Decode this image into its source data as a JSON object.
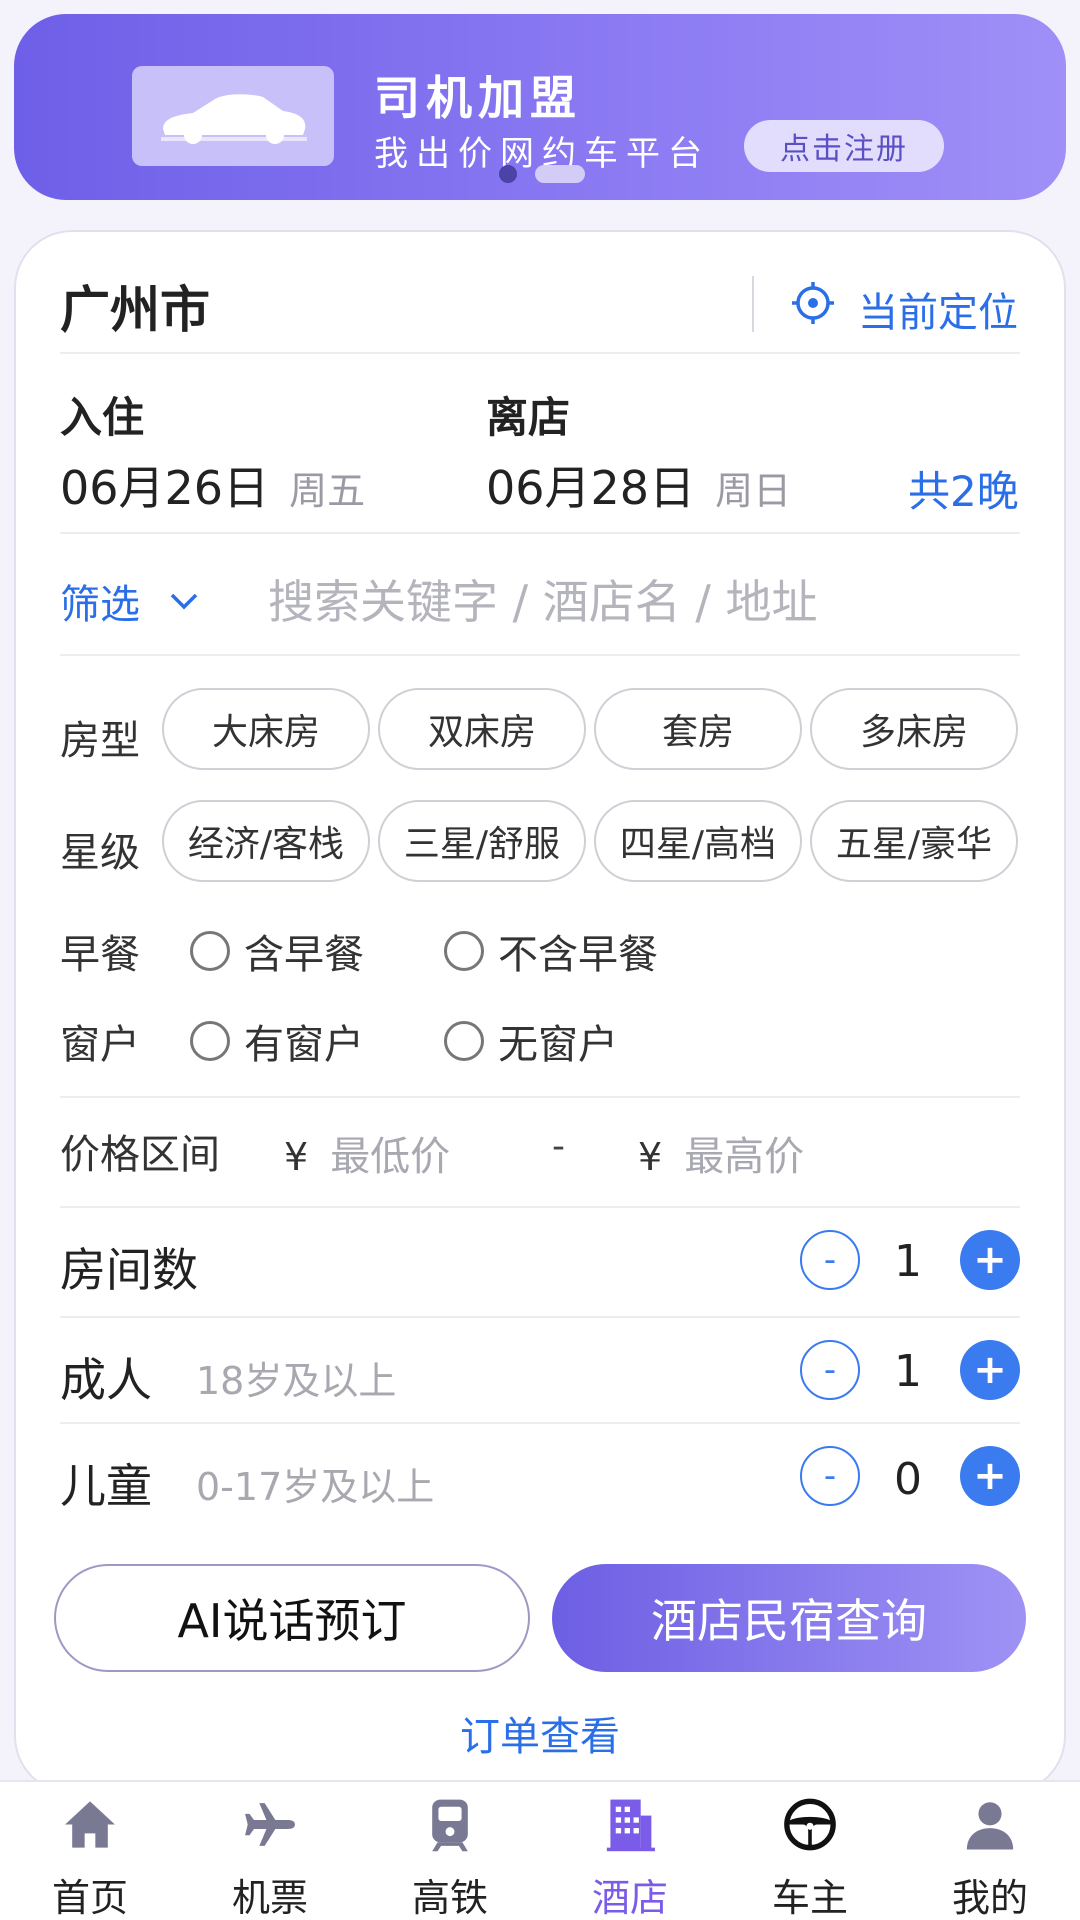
{
  "banner": {
    "title": "司机加盟",
    "subtitle": "我出价网约车平台",
    "button": "点击注册"
  },
  "location": {
    "city": "广州市",
    "current_location": "当前定位"
  },
  "dates": {
    "checkin_label": "入住",
    "checkin_date": "06月26日",
    "checkin_week": "周五",
    "checkout_label": "离店",
    "checkout_date": "06月28日",
    "checkout_week": "周日",
    "nights": "共2晚"
  },
  "search": {
    "filter_label": "筛选",
    "placeholder": "搜索关键字 / 酒店名 / 地址"
  },
  "room_type": {
    "label": "房型",
    "options": [
      "大床房",
      "双床房",
      "套房",
      "多床房"
    ]
  },
  "star": {
    "label": "星级",
    "options": [
      "经济/客栈",
      "三星/舒服",
      "四星/高档",
      "五星/豪华"
    ]
  },
  "breakfast": {
    "label": "早餐",
    "options": [
      "含早餐",
      "不含早餐"
    ]
  },
  "window": {
    "label": "窗户",
    "options": [
      "有窗户",
      "无窗户"
    ]
  },
  "price": {
    "label": "价格区间",
    "currency": "¥",
    "min_placeholder": "最低价",
    "separator": "-",
    "max_placeholder": "最高价"
  },
  "counters": {
    "rooms": {
      "label": "房间数",
      "hint": "",
      "value": "1"
    },
    "adults": {
      "label": "成人",
      "hint": "18岁及以上",
      "value": "1"
    },
    "children": {
      "label": "儿童",
      "hint": "0-17岁及以上",
      "value": "0"
    },
    "minus": "-",
    "plus": "+"
  },
  "actions": {
    "ai_button": "AI说话预订",
    "search_button": "酒店民宿查询",
    "order_link": "订单查看"
  },
  "tabbar": {
    "items": [
      {
        "label": "首页",
        "icon": "home-icon"
      },
      {
        "label": "机票",
        "icon": "plane-icon"
      },
      {
        "label": "高铁",
        "icon": "train-icon"
      },
      {
        "label": "酒店",
        "icon": "hotel-icon",
        "active": true
      },
      {
        "label": "车主",
        "icon": "steering-wheel-icon"
      },
      {
        "label": "我的",
        "icon": "user-icon"
      }
    ]
  },
  "colors": {
    "accent_blue": "#2b6fe8",
    "brand_purple": "#7b5ce8",
    "inactive_icon": "#7a7994"
  }
}
